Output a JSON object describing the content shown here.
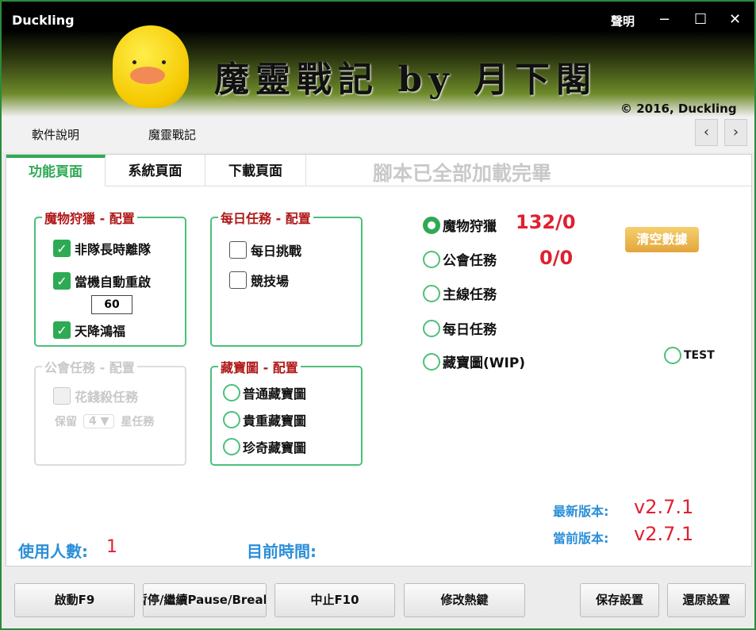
{
  "window": {
    "title": "Duckling",
    "about": "聲明",
    "minimize": "−",
    "maximize": "☐",
    "close": "✕"
  },
  "banner": {
    "text": "魔靈戰記 by 月下閣",
    "copyright": "© 2016, Duckling"
  },
  "menu": {
    "items": [
      "軟件說明",
      "魔靈戰記"
    ],
    "prev": "‹",
    "next": "›"
  },
  "tabs": [
    {
      "label": "功能頁面",
      "active": true
    },
    {
      "label": "系統頁面"
    },
    {
      "label": "下載頁面"
    }
  ],
  "status": "腳本已全部加載完畢",
  "monster_config": {
    "title": "魔物狩獵 - 配置",
    "items": [
      {
        "label": "非隊長時離隊",
        "checked": true
      },
      {
        "label": "當機自動重啟",
        "checked": true
      },
      {
        "label": "天降鴻福",
        "checked": true
      }
    ],
    "restart_value": "60"
  },
  "daily_config": {
    "title": "每日任務 - 配置",
    "items": [
      {
        "label": "每日挑戰",
        "checked": false
      },
      {
        "label": "競技場",
        "checked": false
      }
    ]
  },
  "guild_config": {
    "title": "公會任務 - 配置",
    "item": "花錢殺任務",
    "keep_label": "保留",
    "keep_value": "4 ▼",
    "star_label": "星任務"
  },
  "treasure_config": {
    "title": "藏寶圖 - 配置",
    "items": [
      "普通藏寶圖",
      "貴重藏寶圖",
      "珍奇藏寶圖"
    ]
  },
  "modes": [
    {
      "label": "魔物狩獵",
      "count": "132/0",
      "selected": true
    },
    {
      "label": "公會任務",
      "count": "0/0"
    },
    {
      "label": "主線任務"
    },
    {
      "label": "每日任務"
    },
    {
      "label": "藏寶圖(WIP)"
    }
  ],
  "test_label": "TEST",
  "clear_button": "清空數據",
  "version": {
    "latest_label": "最新版本:",
    "latest": "v2.7.1",
    "current_label": "當前版本:",
    "current": "v2.7.1"
  },
  "users": {
    "label": "使用人數:",
    "value": "1"
  },
  "time": {
    "label": "目前時間:"
  },
  "buttons": [
    "啟動F9",
    "暫停/繼續Pause/Break",
    "中止F10",
    "修改熱鍵",
    "保存設置",
    "還原設置"
  ],
  "colors": {
    "accent": "#2eaa55",
    "red": "#e02030",
    "blue": "#2a8fd8"
  }
}
